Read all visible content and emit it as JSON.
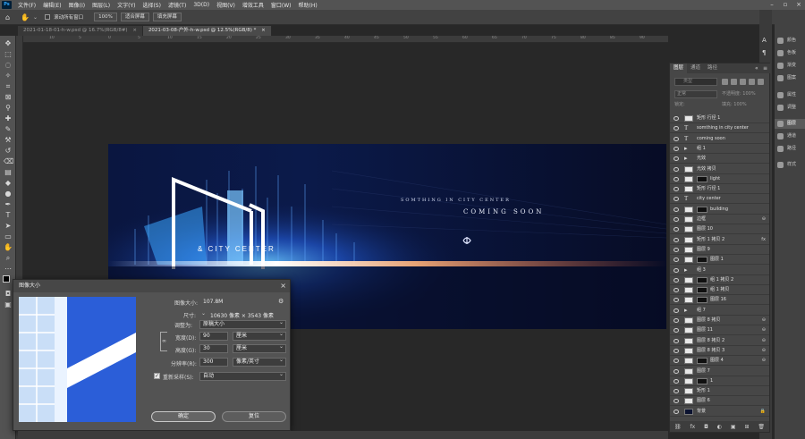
{
  "menubar": {
    "items": [
      "文件(F)",
      "编辑(E)",
      "图像(I)",
      "图层(L)",
      "文字(Y)",
      "选择(S)",
      "滤镜(T)",
      "3D(D)",
      "视图(V)",
      "增效工具",
      "窗口(W)",
      "帮助(H)"
    ],
    "logo": "Ps"
  },
  "optbar": {
    "scroll_all_label": "滚动所有窗口",
    "zoom_value": "100%",
    "fit_screen": "适合屏幕",
    "fill_screen": "填充屏幕"
  },
  "tabs": [
    {
      "label": "2021-01-18-01-h-w.psd @ 16.7%(RGB/8#)",
      "close": "×"
    },
    {
      "label": "2021-03-08-户外-h-w.psd @ 12.5%(RGB/8) *",
      "close": "×"
    }
  ],
  "ruler_ticks": [
    "10",
    "5",
    "0",
    "5",
    "10",
    "15",
    "20",
    "25",
    "30",
    "35",
    "40",
    "45",
    "50",
    "55",
    "60",
    "65",
    "70",
    "75",
    "80",
    "85",
    "90",
    "95",
    "100",
    "105"
  ],
  "artwork": {
    "headline": "SOMTHING IN CITY CENTER",
    "subline": "COMING SOON",
    "city": "& CITY   CENTER"
  },
  "right_panel": {
    "items": [
      {
        "label": "颜色",
        "icon": "color-icon"
      },
      {
        "label": "色板",
        "icon": "swatches-icon"
      },
      {
        "label": "渐变",
        "icon": "gradient-icon"
      },
      {
        "label": "图案",
        "icon": "pattern-icon"
      },
      {
        "label": "属性",
        "icon": "properties-icon"
      },
      {
        "label": "调整",
        "icon": "adjustments-icon"
      },
      {
        "label": "图层",
        "icon": "layers-icon"
      },
      {
        "label": "通道",
        "icon": "channels-icon"
      },
      {
        "label": "路径",
        "icon": "paths-icon"
      },
      {
        "label": "样式",
        "icon": "styles-icon"
      }
    ]
  },
  "layers": {
    "tabs": [
      "图层",
      "通道",
      "路径"
    ],
    "search_placeholder": "类型",
    "blend_mode": "正常",
    "opacity_label": "不透明度: 100%",
    "lock_label": "锁定:",
    "fill_label": "填充: 100%",
    "items": [
      {
        "name": "矩形 行径 1",
        "type": "shape"
      },
      {
        "name": "somthing in city center",
        "type": "text"
      },
      {
        "name": "coming soon",
        "type": "text"
      },
      {
        "name": "组 1",
        "type": "group"
      },
      {
        "name": "光效",
        "type": "group"
      },
      {
        "name": "光效 拷贝",
        "type": "pixel"
      },
      {
        "name": "light",
        "type": "masked"
      },
      {
        "name": "矩形 行径 1",
        "type": "shape"
      },
      {
        "name": "city   center",
        "type": "text"
      },
      {
        "name": "building",
        "type": "masked"
      },
      {
        "name": "边框",
        "type": "pixel",
        "fx": "⊖"
      },
      {
        "name": "图层 10",
        "type": "pixel"
      },
      {
        "name": "矩形 1 拷贝 2",
        "type": "shape",
        "fx": "fx"
      },
      {
        "name": "图层 9",
        "type": "pixel"
      },
      {
        "name": "图层 1",
        "type": "masked"
      },
      {
        "name": "组 3",
        "type": "group"
      },
      {
        "name": "组 1 拷贝 2",
        "type": "masked"
      },
      {
        "name": "组 1 拷贝",
        "type": "masked"
      },
      {
        "name": "图层 16",
        "type": "masked"
      },
      {
        "name": "组 7",
        "type": "group"
      },
      {
        "name": "图层 8 拷贝",
        "type": "pixel",
        "fx": "⊖"
      },
      {
        "name": "图层 11",
        "type": "pixel",
        "fx": "⊖"
      },
      {
        "name": "图层 8 拷贝 2",
        "type": "pixel",
        "fx": "⊖"
      },
      {
        "name": "图层 8 拷贝 3",
        "type": "pixel",
        "fx": "⊖"
      },
      {
        "name": "图层 4",
        "type": "masked",
        "fx": "⊖"
      },
      {
        "name": "图层 7",
        "type": "pixel"
      },
      {
        "name": "1",
        "type": "masked"
      },
      {
        "name": "矩形 1",
        "type": "pixel"
      },
      {
        "name": "图层 6",
        "type": "pixel"
      },
      {
        "name": "背景",
        "type": "background",
        "fx": "🔒"
      }
    ]
  },
  "dialog": {
    "title": "图像大小",
    "size_label": "图像大小:",
    "size_value": "107.8M",
    "dimensions_label": "尺寸:",
    "dimensions_value": "10630 像素 × 3543 像素",
    "fit_label": "调整为:",
    "fit_value": "原稿大小",
    "width_label": "宽度(D):",
    "width_value": "90",
    "width_unit": "厘米",
    "height_label": "高度(G):",
    "height_value": "30",
    "height_unit": "厘米",
    "resolution_label": "分辨率(R):",
    "resolution_value": "300",
    "resolution_unit": "像素/英寸",
    "resample_label": "重新采样(S):",
    "resample_value": "自动",
    "ok": "确定",
    "reset": "复位"
  },
  "colors": {
    "accent": "#31a8ff",
    "canvas_bg": "#070c25",
    "panel_bg": "#474747"
  }
}
